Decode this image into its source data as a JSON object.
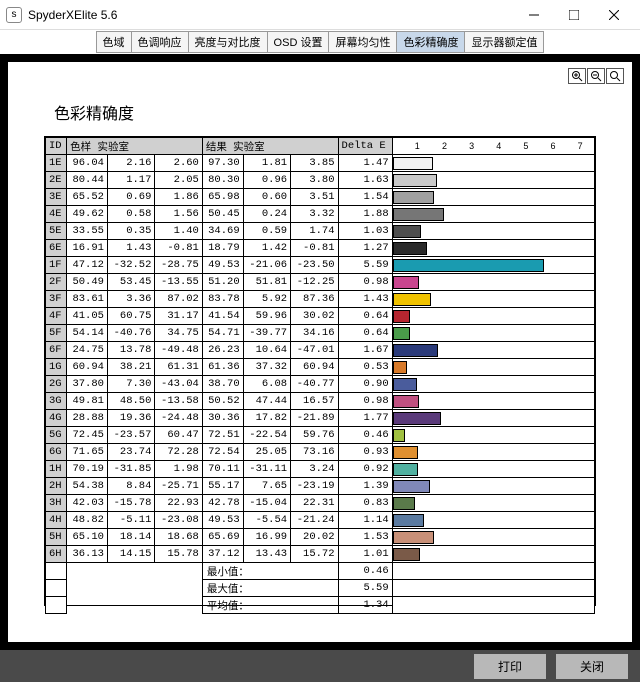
{
  "window": {
    "title": "SpyderXElite 5.6"
  },
  "tabs": [
    "色域",
    "色调响应",
    "亮度与对比度",
    "OSD 设置",
    "屏幕均匀性",
    "色彩精确度",
    "显示器额定值"
  ],
  "active_tab": 5,
  "page_title": "色彩精确度",
  "headers": {
    "id": "ID",
    "sample": "色样 实验室",
    "result": "结果 实验室",
    "delta": "Delta E"
  },
  "axis_labels": [
    "1",
    "2",
    "3",
    "4",
    "5",
    "6",
    "7"
  ],
  "axis_max": 7,
  "chart_data": {
    "type": "bar",
    "xlabel": "Delta E",
    "ylabel": "ID",
    "rows": [
      {
        "id": "1E",
        "s": [
          96.04,
          2.16,
          2.6
        ],
        "r": [
          97.3,
          1.81,
          3.85
        ],
        "de": 1.47,
        "c": "#f2f2f2"
      },
      {
        "id": "2E",
        "s": [
          80.44,
          1.17,
          2.05
        ],
        "r": [
          80.3,
          0.96,
          3.8
        ],
        "de": 1.63,
        "c": "#c9c9c9"
      },
      {
        "id": "3E",
        "s": [
          65.52,
          0.69,
          1.86
        ],
        "r": [
          65.98,
          0.6,
          3.51
        ],
        "de": 1.54,
        "c": "#a0a0a0"
      },
      {
        "id": "4E",
        "s": [
          49.62,
          0.58,
          1.56
        ],
        "r": [
          50.45,
          0.24,
          3.32
        ],
        "de": 1.88,
        "c": "#767676"
      },
      {
        "id": "5E",
        "s": [
          33.55,
          0.35,
          1.4
        ],
        "r": [
          34.69,
          0.59,
          1.74
        ],
        "de": 1.03,
        "c": "#4d4d4d"
      },
      {
        "id": "6E",
        "s": [
          16.91,
          1.43,
          -0.81
        ],
        "r": [
          18.79,
          1.42,
          -0.81
        ],
        "de": 1.27,
        "c": "#2a2a2a"
      },
      {
        "id": "1F",
        "s": [
          47.12,
          -32.52,
          -28.75
        ],
        "r": [
          49.53,
          -21.06,
          -23.5
        ],
        "de": 5.59,
        "c": "#1a9bb0"
      },
      {
        "id": "2F",
        "s": [
          50.49,
          53.45,
          -13.55
        ],
        "r": [
          51.2,
          51.81,
          -12.25
        ],
        "de": 0.98,
        "c": "#c9458f"
      },
      {
        "id": "3F",
        "s": [
          83.61,
          3.36,
          87.02
        ],
        "r": [
          83.78,
          5.92,
          87.36
        ],
        "de": 1.43,
        "c": "#f0c200"
      },
      {
        "id": "4F",
        "s": [
          41.05,
          60.75,
          31.17
        ],
        "r": [
          41.54,
          59.96,
          30.02
        ],
        "de": 0.64,
        "c": "#b52630"
      },
      {
        "id": "5F",
        "s": [
          54.14,
          -40.76,
          34.75
        ],
        "r": [
          54.71,
          -39.77,
          34.16
        ],
        "de": 0.64,
        "c": "#4a9c4a"
      },
      {
        "id": "6F",
        "s": [
          24.75,
          13.78,
          -49.48
        ],
        "r": [
          26.23,
          10.64,
          -47.01
        ],
        "de": 1.67,
        "c": "#2a3a7a"
      },
      {
        "id": "1G",
        "s": [
          60.94,
          38.21,
          61.31
        ],
        "r": [
          61.36,
          37.32,
          60.94
        ],
        "de": 0.53,
        "c": "#d87a2a"
      },
      {
        "id": "2G",
        "s": [
          37.8,
          7.3,
          -43.04
        ],
        "r": [
          38.7,
          6.08,
          -40.77
        ],
        "de": 0.9,
        "c": "#4a5c9c"
      },
      {
        "id": "3G",
        "s": [
          49.81,
          48.5,
          -13.58
        ],
        "r": [
          50.52,
          47.44,
          16.57
        ],
        "de": 0.98,
        "c": "#c05080"
      },
      {
        "id": "4G",
        "s": [
          28.88,
          19.36,
          -24.48
        ],
        "r": [
          30.36,
          17.82,
          -21.89
        ],
        "de": 1.77,
        "c": "#5a3a7a"
      },
      {
        "id": "5G",
        "s": [
          72.45,
          -23.57,
          60.47
        ],
        "r": [
          72.51,
          -22.54,
          59.76
        ],
        "de": 0.46,
        "c": "#a0c040"
      },
      {
        "id": "6G",
        "s": [
          71.65,
          23.74,
          72.28
        ],
        "r": [
          72.54,
          25.05,
          73.16
        ],
        "de": 0.93,
        "c": "#e09030"
      },
      {
        "id": "1H",
        "s": [
          70.19,
          -31.85,
          1.98
        ],
        "r": [
          70.11,
          -31.11,
          3.24
        ],
        "de": 0.92,
        "c": "#50b0a0"
      },
      {
        "id": "2H",
        "s": [
          54.38,
          8.84,
          -25.71
        ],
        "r": [
          55.17,
          7.65,
          -23.19
        ],
        "de": 1.39,
        "c": "#8088b8"
      },
      {
        "id": "3H",
        "s": [
          42.03,
          -15.78,
          22.93
        ],
        "r": [
          42.78,
          -15.04,
          22.31
        ],
        "de": 0.83,
        "c": "#5a7a4a"
      },
      {
        "id": "4H",
        "s": [
          48.82,
          -5.11,
          -23.08
        ],
        "r": [
          49.53,
          -5.54,
          -21.24
        ],
        "de": 1.14,
        "c": "#5a7aa0"
      },
      {
        "id": "5H",
        "s": [
          65.1,
          18.14,
          18.68
        ],
        "r": [
          65.69,
          16.99,
          20.02
        ],
        "de": 1.53,
        "c": "#c89078"
      },
      {
        "id": "6H",
        "s": [
          36.13,
          14.15,
          15.78
        ],
        "r": [
          37.12,
          13.43,
          15.72
        ],
        "de": 1.01,
        "c": "#7a5a48"
      }
    ],
    "summary": [
      {
        "label": "最小值：",
        "value": 0.46
      },
      {
        "label": "最大值：",
        "value": 5.59
      },
      {
        "label": "平均值：",
        "value": 1.34
      }
    ]
  },
  "footer": {
    "print": "打印",
    "close": "关闭"
  }
}
